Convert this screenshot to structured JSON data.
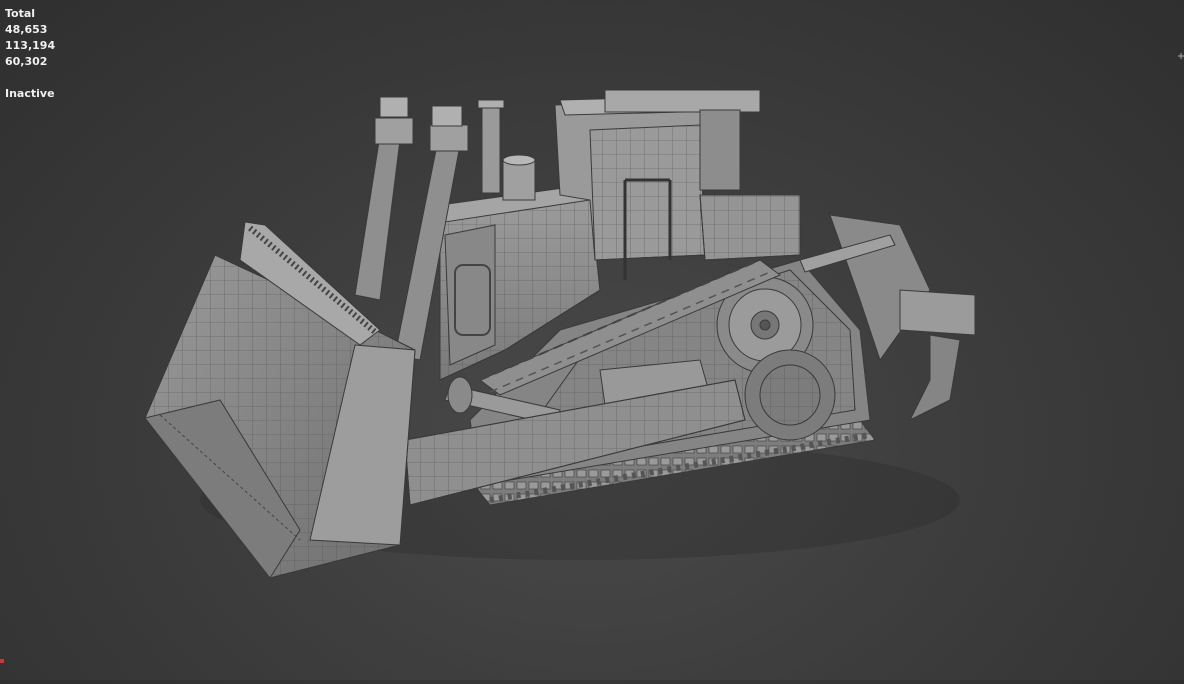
{
  "stats": {
    "label": "Total",
    "polys": "48,653",
    "tris": "113,194",
    "verts": "60,302",
    "status": "Inactive"
  },
  "viewport": {
    "background_center": "#4a4a4a",
    "background_edge": "#2f2f2f",
    "model_color": "#8e8e8e",
    "wire_color": "#3a3a3a"
  }
}
